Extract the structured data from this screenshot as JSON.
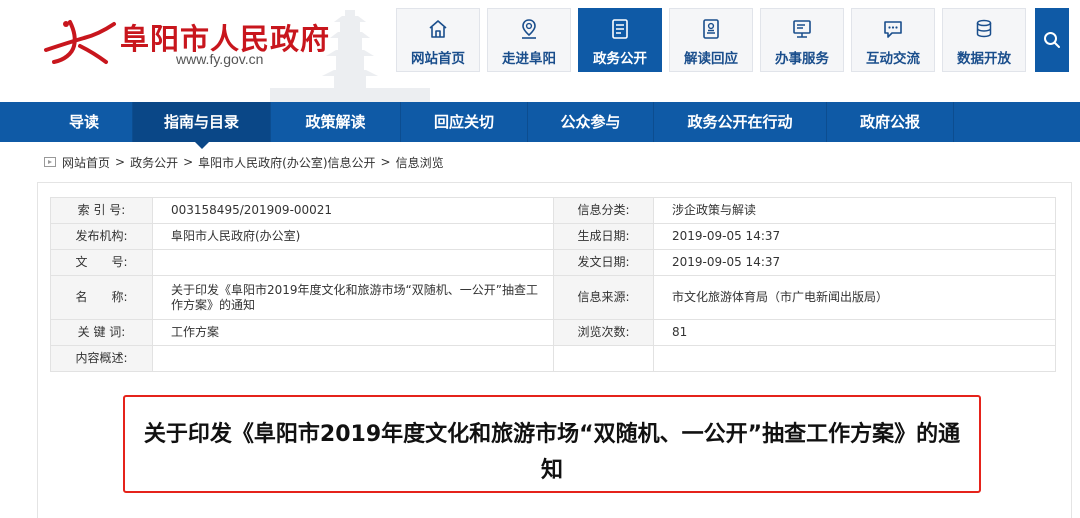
{
  "header": {
    "site_name": "阜阳市人民政府",
    "site_url": "www.fy.gov.cn",
    "top_nav": [
      {
        "label": "网站首页",
        "icon": "home-icon",
        "active": false
      },
      {
        "label": "走进阜阳",
        "icon": "location-pin-icon",
        "active": false
      },
      {
        "label": "政务公开",
        "icon": "document-list-icon",
        "active": true
      },
      {
        "label": "解读回应",
        "icon": "id-card-icon",
        "active": false
      },
      {
        "label": "办事服务",
        "icon": "monitor-icon",
        "active": false
      },
      {
        "label": "互动交流",
        "icon": "chat-bubble-icon",
        "active": false
      },
      {
        "label": "数据开放",
        "icon": "database-icon",
        "active": false
      }
    ],
    "search_icon": "search-icon"
  },
  "main_nav": [
    {
      "label": "导读",
      "active": false
    },
    {
      "label": "指南与目录",
      "active": true
    },
    {
      "label": "政策解读",
      "active": false
    },
    {
      "label": "回应关切",
      "active": false
    },
    {
      "label": "公众参与",
      "active": false
    },
    {
      "label": "政务公开在行动",
      "active": false
    },
    {
      "label": "政府公报",
      "active": false
    }
  ],
  "breadcrumb": {
    "items": [
      "网站首页",
      "政务公开",
      "阜阳市人民政府(办公室)信息公开",
      "信息浏览"
    ],
    "separator": ">"
  },
  "meta": {
    "rows": [
      {
        "label1": "索 引 号:",
        "value1": "003158495/201909-00021",
        "label2": "信息分类:",
        "value2": "涉企政策与解读"
      },
      {
        "label1": "发布机构:",
        "value1": "阜阳市人民政府(办公室)",
        "label2": "生成日期:",
        "value2": "2019-09-05 14:37"
      },
      {
        "label1": "文　　号:",
        "value1": "",
        "label2": "发文日期:",
        "value2": "2019-09-05 14:37"
      },
      {
        "label1": "名　　称:",
        "value1": "关于印发《阜阳市2019年度文化和旅游市场“双随机、一公开”抽查工作方案》的通知",
        "label2": "信息来源:",
        "value2": "市文化旅游体育局（市广电新闻出版局）"
      },
      {
        "label1": "关 键 词:",
        "value1": "工作方案",
        "label2": "浏览次数:",
        "value2": "81"
      },
      {
        "label1": "内容概述:",
        "value1": "",
        "label2": "",
        "value2": ""
      }
    ]
  },
  "document": {
    "title": "关于印发《阜阳市2019年度文化和旅游市场“双随机、一公开”抽查工作方案》的通知"
  },
  "colors": {
    "brand_red": "#c8161d",
    "nav_blue": "#0f5aa6",
    "highlight_red": "#e5231b"
  }
}
